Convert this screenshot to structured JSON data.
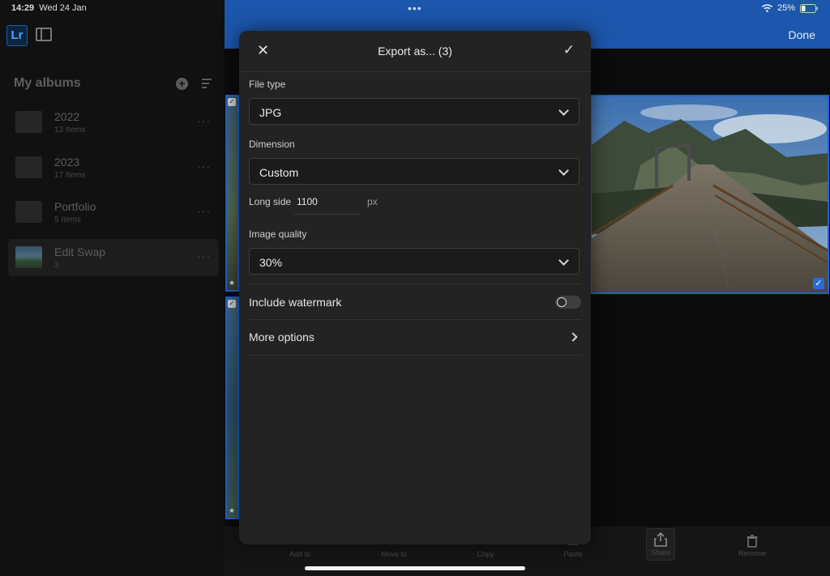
{
  "status_bar": {
    "time": "14:29",
    "date": "Wed 24 Jan",
    "battery": "25%"
  },
  "sidebar": {
    "title": "My albums",
    "albums": [
      {
        "name": "2022",
        "count": "13 Items"
      },
      {
        "name": "2023",
        "count": "17 Items"
      },
      {
        "name": "Portfolio",
        "count": "5 Items"
      },
      {
        "name": "Edit Swap",
        "count": "3"
      }
    ]
  },
  "header": {
    "done_label": "Done"
  },
  "toolbar": {
    "items": [
      {
        "label": "Add to"
      },
      {
        "label": "Move to"
      },
      {
        "label": "Copy"
      },
      {
        "label": "Paste"
      },
      {
        "label": "Share"
      },
      {
        "label": "Remove"
      }
    ]
  },
  "modal": {
    "title": "Export as... (3)",
    "file_type": {
      "label": "File type",
      "value": "JPG"
    },
    "dimension": {
      "label": "Dimension",
      "value": "Custom"
    },
    "long_side": {
      "label": "Long side",
      "value": "1100",
      "unit": "px"
    },
    "image_quality": {
      "label": "Image quality",
      "value": "30%"
    },
    "watermark": {
      "label": "Include watermark",
      "enabled": false
    },
    "more_options": {
      "label": "More options"
    }
  },
  "colors": {
    "accent": "#1c57ad",
    "selection": "#1f63c9",
    "modal_bg": "#232323"
  }
}
